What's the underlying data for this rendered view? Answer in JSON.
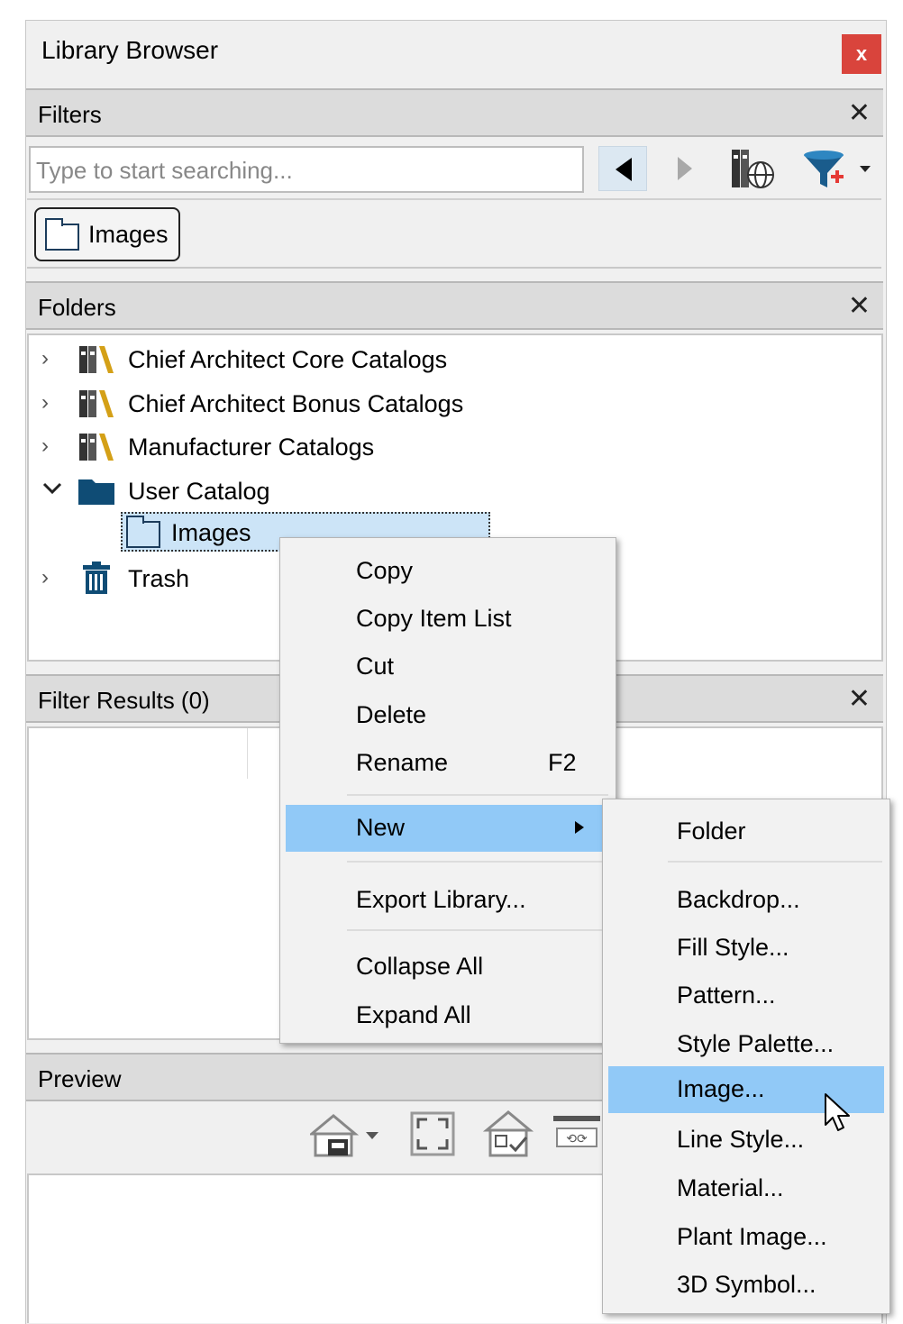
{
  "window": {
    "title": "Library Browser",
    "close_symbol": "x"
  },
  "filters": {
    "header": "Filters",
    "close_symbol": "✕",
    "search_placeholder": "Type to start searching...",
    "chip_label": "Images"
  },
  "folders": {
    "header": "Folders",
    "close_symbol": "✕",
    "items": [
      {
        "label": "Chief Architect Core Catalogs",
        "icon": "library-books-icon"
      },
      {
        "label": "Chief Architect Bonus Catalogs",
        "icon": "library-books-icon"
      },
      {
        "label": "Manufacturer Catalogs",
        "icon": "library-books-icon"
      },
      {
        "label": "User Catalog",
        "icon": "folder-filled-icon"
      },
      {
        "label": "Images",
        "icon": "folder-icon"
      },
      {
        "label": "Trash",
        "icon": "trash-icon"
      }
    ]
  },
  "filter_results": {
    "header": "Filter Results (0)",
    "close_symbol": "✕"
  },
  "preview": {
    "header": "Preview"
  },
  "context_menu": {
    "items": [
      {
        "label": "Copy"
      },
      {
        "label": "Copy Item List"
      },
      {
        "label": "Cut"
      },
      {
        "label": "Delete"
      },
      {
        "label": "Rename",
        "shortcut": "F2"
      },
      {
        "label": "New",
        "submenu": true
      },
      {
        "label": "Export Library..."
      },
      {
        "label": "Collapse All"
      },
      {
        "label": "Expand All"
      }
    ]
  },
  "submenu": {
    "items": [
      {
        "label": "Folder"
      },
      {
        "label": "Backdrop..."
      },
      {
        "label": "Fill Style..."
      },
      {
        "label": "Pattern..."
      },
      {
        "label": "Style Palette..."
      },
      {
        "label": "Image..."
      },
      {
        "label": "Line Style..."
      },
      {
        "label": "Material..."
      },
      {
        "label": "Plant Image..."
      },
      {
        "label": "3D Symbol..."
      }
    ]
  },
  "colors": {
    "highlight": "#91c9f7",
    "close_red": "#d9443c",
    "folder_blue": "#0f4c75"
  }
}
